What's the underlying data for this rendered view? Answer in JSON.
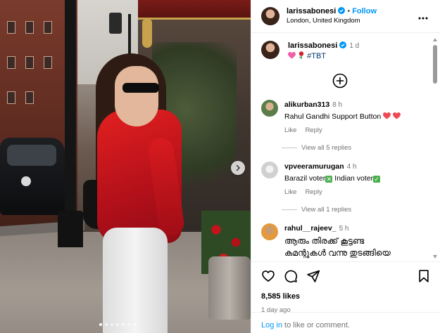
{
  "post": {
    "photo_alt": "Woman in red jacket on a London street",
    "carousel_dots": 7,
    "active_dot": 0
  },
  "header": {
    "username": "larissabonesi",
    "separator": "•",
    "follow_label": "Follow",
    "location": "London, United Kingdom",
    "more_icon": "more-horizontal-icon"
  },
  "caption": {
    "username": "larissabonesi",
    "time": "1 d",
    "hashtag": "#TBT"
  },
  "comments": [
    {
      "username": "alikurban313",
      "time": "8 h",
      "text": "Rahul Gandhi Support Button",
      "like_label": "Like",
      "reply_label": "Reply",
      "view_replies": "View all 5 replies"
    },
    {
      "username": "vpveeramurugan",
      "time": "4 h",
      "text_a": "Barazil voter",
      "text_b": "Indian voter",
      "like_label": "Like",
      "reply_label": "Reply",
      "view_replies": "View all 1 replies"
    },
    {
      "username": "rahul__rajeev_",
      "time": "5 h",
      "text_line1": "ആരും തിരക്ക് കൂട്ടണ്ട",
      "text_line2": "കമന്റുകൾ വന്നു തുടങ്ങിയെ"
    }
  ],
  "actions": {
    "likes": "8,585 likes",
    "posted": "1 day ago"
  },
  "login": {
    "link": "Log in",
    "text": " to like or comment."
  },
  "colors": {
    "accent": "#0095f6",
    "verified": "#0095f6",
    "heart": "#ed4956",
    "green_check": "#48b04a",
    "red_cross": "#4caf50"
  }
}
